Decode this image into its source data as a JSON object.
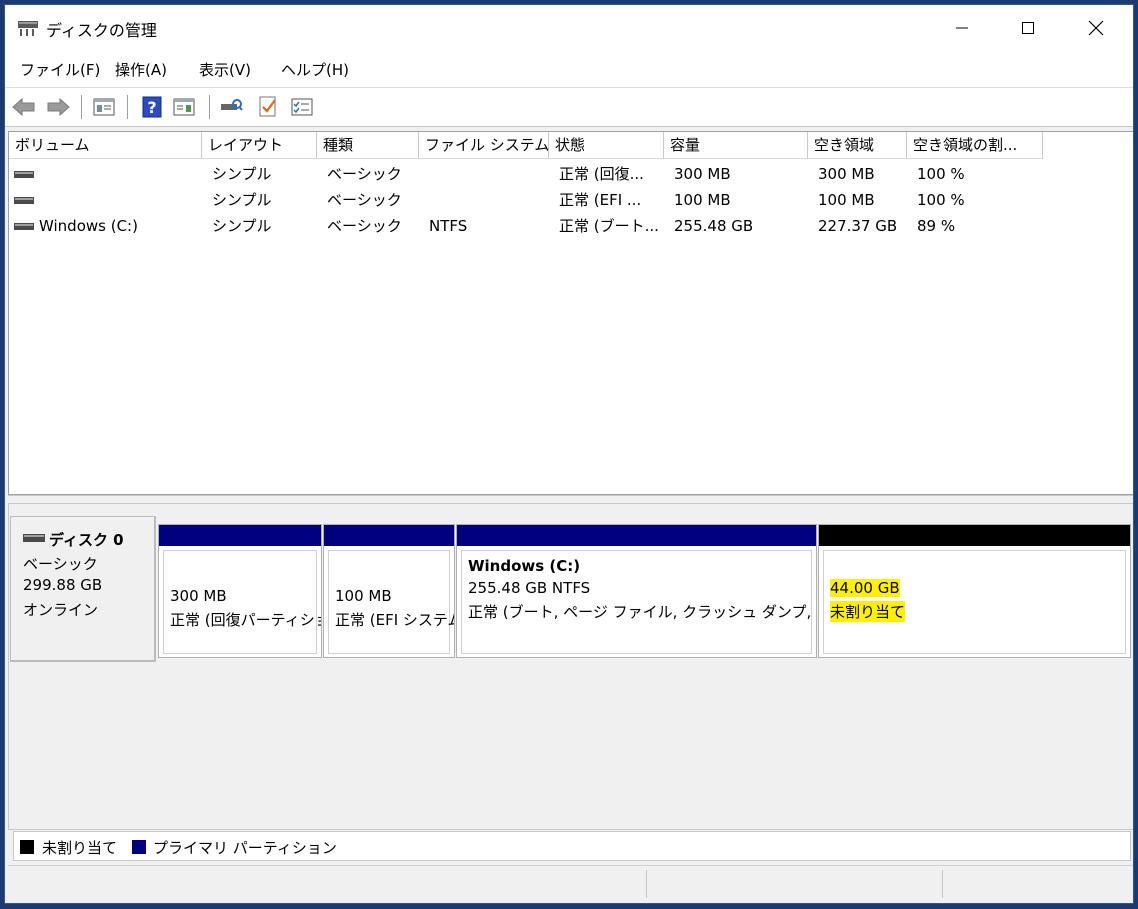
{
  "window": {
    "title": "ディスクの管理"
  },
  "menu": [
    "ファイル(F)",
    "操作(A)",
    "表示(V)",
    "ヘルプ(H)"
  ],
  "columns": [
    "ボリューム",
    "レイアウト",
    "種類",
    "ファイル システム",
    "状態",
    "容量",
    "空き領域",
    "空き領域の割..."
  ],
  "volumes": [
    {
      "name": "",
      "layout": "シンプル",
      "type": "ベーシック",
      "fs": "",
      "status": "正常 (回復...",
      "capacity": "300 MB",
      "free": "300 MB",
      "pct": "100 %"
    },
    {
      "name": "",
      "layout": "シンプル",
      "type": "ベーシック",
      "fs": "",
      "status": "正常 (EFI ...",
      "capacity": "100 MB",
      "free": "100 MB",
      "pct": "100 %"
    },
    {
      "name": "Windows (C:)",
      "layout": "シンプル",
      "type": "ベーシック",
      "fs": "NTFS",
      "status": "正常 (ブート...",
      "capacity": "255.48 GB",
      "free": "227.37 GB",
      "pct": "89 %"
    }
  ],
  "disk": {
    "name": "ディスク 0",
    "type": "ベーシック",
    "size": "299.88 GB",
    "state": "オンライン"
  },
  "partitions": [
    {
      "title": "",
      "line1": "300 MB",
      "line2": "正常 (回復パーティション)"
    },
    {
      "title": "",
      "line1": "100 MB",
      "line2": "正常 (EFI システム パーティション)"
    },
    {
      "title": "Windows  (C:)",
      "line1": "255.48 GB NTFS",
      "line2": "正常 (ブート, ページ ファイル, クラッシュ ダンプ, プライマリ パーティション)"
    },
    {
      "title": "",
      "line1": "44.00 GB",
      "line2": "未割り当て"
    }
  ],
  "legend": [
    {
      "label": "未割り当て",
      "color": "#000000"
    },
    {
      "label": "プライマリ パーティション",
      "color": "#000080"
    }
  ],
  "colors": {
    "primary": "#000080",
    "unallocated": "#000000",
    "highlight": "#ffef00"
  }
}
